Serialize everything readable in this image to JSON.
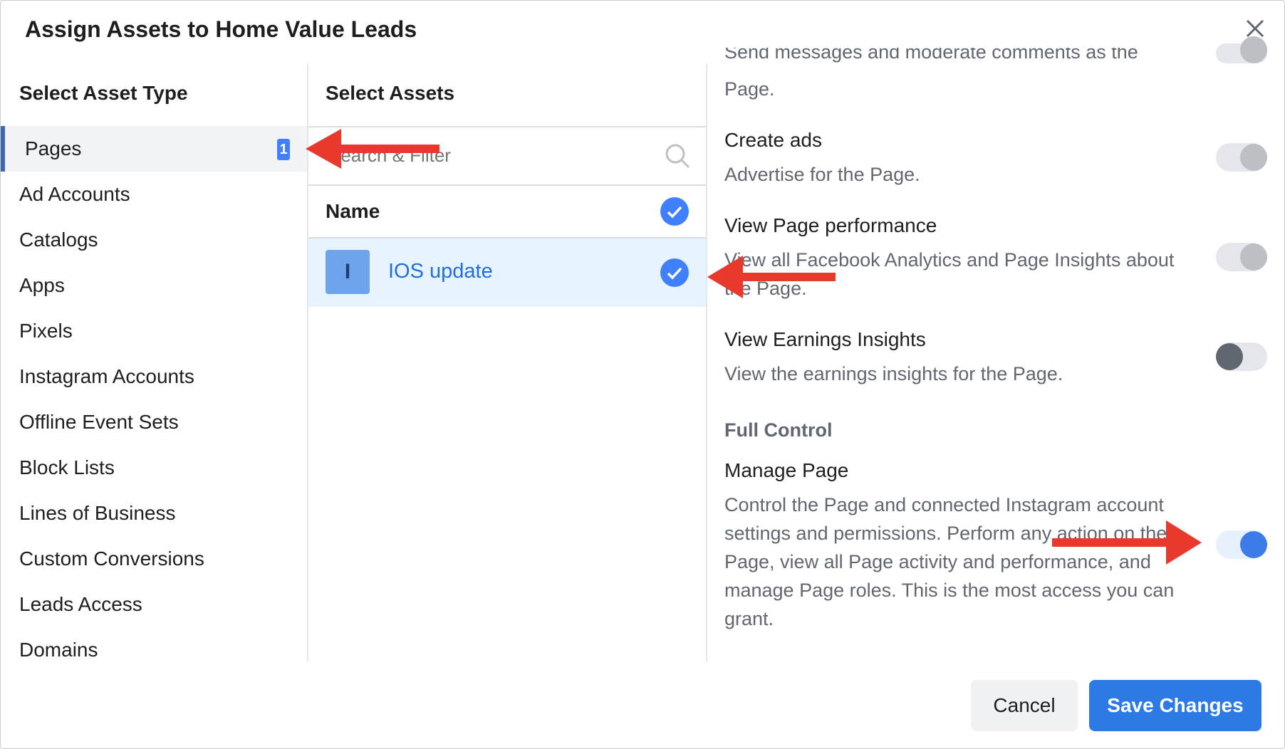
{
  "dialog": {
    "title": "Assign Assets to Home Value Leads"
  },
  "asset_types": {
    "header": "Select Asset Type",
    "items": [
      {
        "label": "Pages",
        "count": "1",
        "selected": true
      },
      {
        "label": "Ad Accounts"
      },
      {
        "label": "Catalogs"
      },
      {
        "label": "Apps"
      },
      {
        "label": "Pixels"
      },
      {
        "label": "Instagram Accounts"
      },
      {
        "label": "Offline Event Sets"
      },
      {
        "label": "Block Lists"
      },
      {
        "label": "Lines of Business"
      },
      {
        "label": "Custom Conversions"
      },
      {
        "label": "Leads Access"
      },
      {
        "label": "Domains"
      }
    ]
  },
  "assets": {
    "header": "Select Assets",
    "search_placeholder": "Search & Filter",
    "column_name": "Name",
    "rows": [
      {
        "avatar_letter": "I",
        "name": "IOS update",
        "checked": true
      }
    ]
  },
  "permissions": {
    "partial_top": {
      "desc_cut": "Send messages and moderate comments as the",
      "desc_end": "Page."
    },
    "items": [
      {
        "title": "Create ads",
        "desc": "Advertise for the Page.",
        "enabled": false
      },
      {
        "title": "View Page performance",
        "desc": "View all Facebook Analytics and Page Insights about the Page.",
        "enabled": false
      },
      {
        "title": "View Earnings Insights",
        "desc": "View the earnings insights for the Page.",
        "enabled": false
      }
    ],
    "full_control_label": "Full Control",
    "manage_page": {
      "title": "Manage Page",
      "desc": "Control the Page and connected Instagram account settings and permissions. Perform any action on the Page, view all Page activity and performance, and manage Page roles. This is the most access you can grant.",
      "enabled": true
    }
  },
  "footer": {
    "cancel": "Cancel",
    "save": "Save Changes"
  },
  "colors": {
    "accent": "#2d7ae5",
    "annotation_arrow": "#e8392c"
  }
}
